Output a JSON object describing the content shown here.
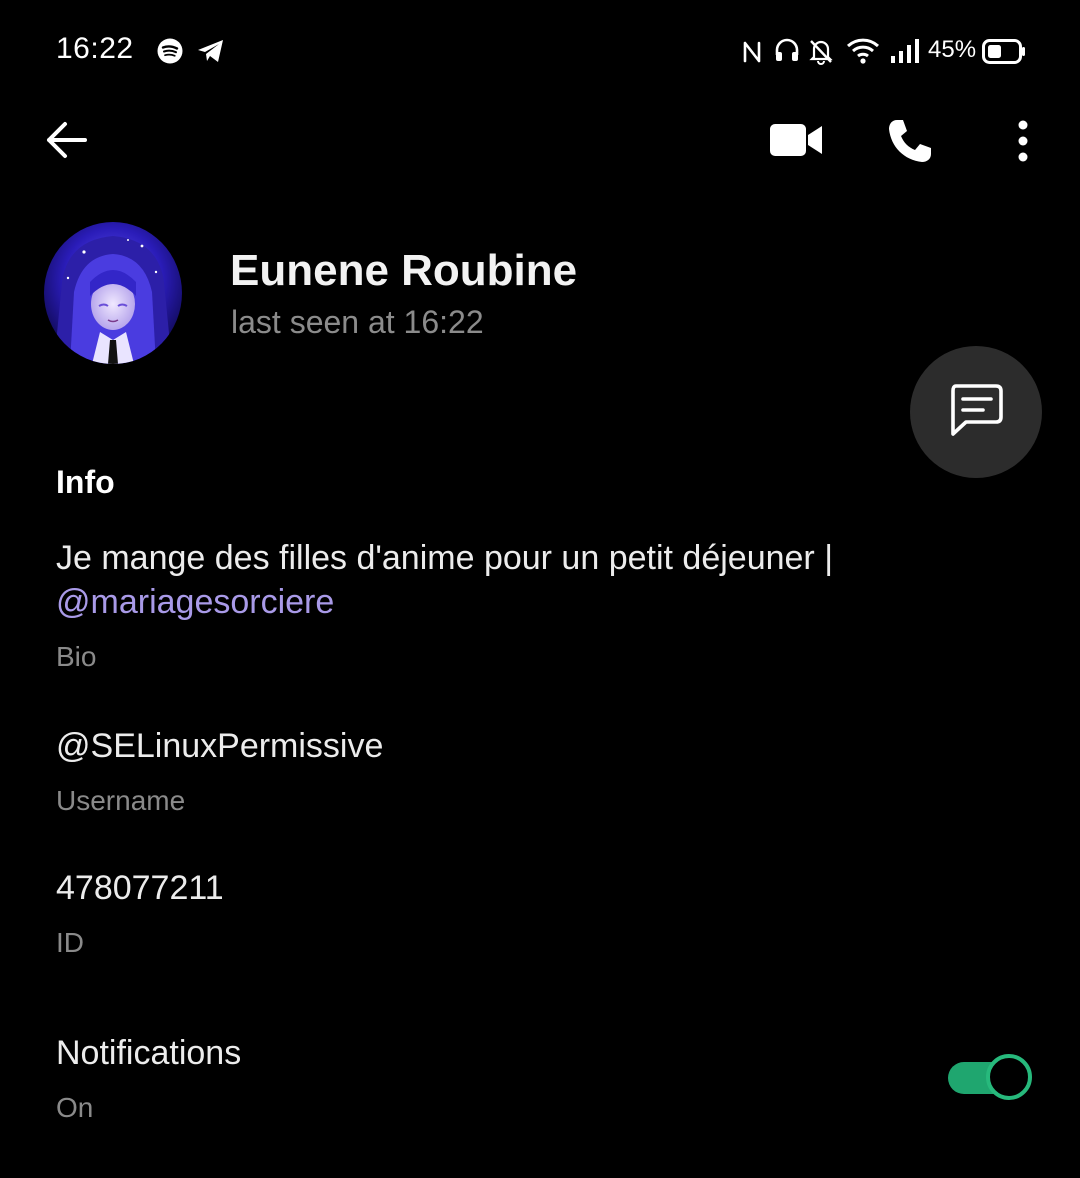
{
  "status_bar": {
    "time": "16:22",
    "battery_percent": "45%",
    "left_icons": [
      "spotify-icon",
      "telegram-icon"
    ],
    "right_icons": [
      "nfc-icon",
      "headset-icon",
      "bell-muted-icon",
      "wifi-icon",
      "signal-icon",
      "battery-icon"
    ]
  },
  "app_bar": {
    "icons": [
      "back-arrow-icon",
      "video-call-icon",
      "phone-icon",
      "more-vert-icon"
    ]
  },
  "profile": {
    "name": "Eunene Roubine",
    "status": "last seen at 16:22"
  },
  "info": {
    "title": "Info",
    "bio_text": "Je mange des filles d'anime pour un petit déjeuner |",
    "bio_mention": "@mariagesorciere",
    "bio_label": "Bio",
    "username": "@SELinuxPermissive",
    "username_label": "Username",
    "id": "478077211",
    "id_label": "ID",
    "notifications": "Notifications",
    "notifications_state": "On",
    "notifications_enabled": true
  },
  "colors": {
    "background": "#000000",
    "accent_toggle": "#1fa66f",
    "mention": "#a99ae8",
    "secondary_text": "#8a8a8a",
    "fab_bg": "#2c2c2c"
  }
}
